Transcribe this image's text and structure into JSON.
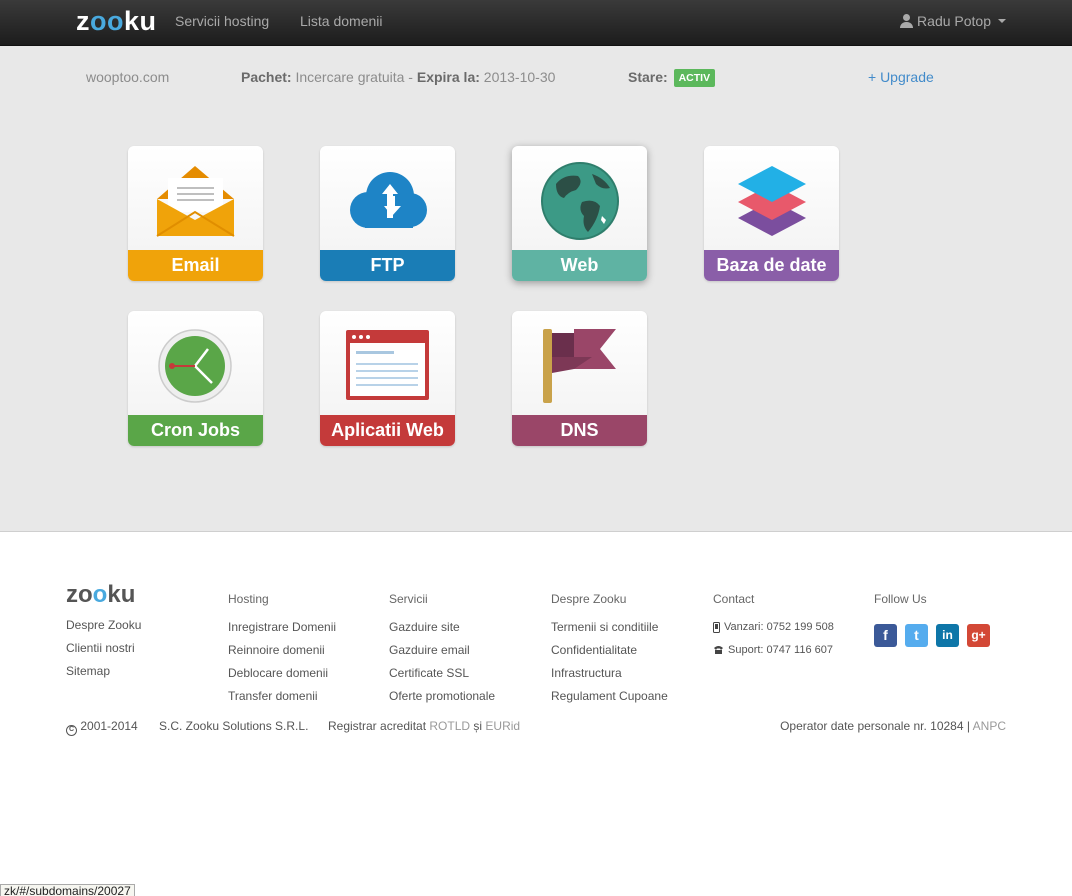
{
  "navbar": {
    "logo": {
      "part1": "zoo",
      "part2": "k",
      "part3": "u"
    },
    "links": [
      "Servicii hosting",
      "Lista domenii"
    ],
    "user": "Radu Potop"
  },
  "info": {
    "domain": "wooptoo.com",
    "package_label": "Pachet:",
    "package_value": "Incercare gratuita -",
    "expires_label": "Expira la:",
    "expires_value": "2013-10-30",
    "status_label": "Stare:",
    "status_badge": "ACTIV",
    "upgrade": "+ Upgrade"
  },
  "tiles": [
    {
      "label": "Email",
      "icon": "envelope-icon",
      "color": "#f0a30a"
    },
    {
      "label": "FTP",
      "icon": "cloud-transfer-icon",
      "color": "#1a7db6"
    },
    {
      "label": "Web",
      "icon": "globe-icon",
      "color": "#5fb3a3"
    },
    {
      "label": "Baza de date",
      "icon": "database-layers-icon",
      "color": "#8a5ea8"
    },
    {
      "label": "Cron Jobs",
      "icon": "clock-icon",
      "color": "#5aa648"
    },
    {
      "label": "Aplicatii Web",
      "icon": "browser-window-icon",
      "color": "#c43a3a"
    },
    {
      "label": "DNS",
      "icon": "flag-icon",
      "color": "#9a4668"
    }
  ],
  "footer": {
    "logo": {
      "part1": "zoo",
      "part2": "ku"
    },
    "about": [
      "Despre Zooku",
      "Clientii nostri",
      "Sitemap"
    ],
    "hosting": {
      "head": "Hosting",
      "items": [
        "Inregistrare Domenii",
        "Reinnoire domenii",
        "Deblocare domenii",
        "Transfer domenii"
      ]
    },
    "servicii": {
      "head": "Servicii",
      "items": [
        "Gazduire site",
        "Gazduire email",
        "Certificate SSL",
        "Oferte promotionale"
      ]
    },
    "despre": {
      "head": "Despre Zooku",
      "items": [
        "Termenii si conditiile",
        "Confidentialitate",
        "Infrastructura",
        "Regulament Cupoane"
      ]
    },
    "contact": {
      "head": "Contact",
      "sales": "Vanzari: 0752 199 508",
      "support": "Suport: 0747 116 607"
    },
    "follow": {
      "head": "Follow Us",
      "networks": [
        "facebook-icon",
        "twitter-icon",
        "linkedin-icon",
        "google-plus-icon"
      ]
    },
    "copyright_symbol": "C",
    "copyright_years": "2001-2014",
    "company": "S.C. Zooku Solutions S.R.L.",
    "registrar_text": "Registrar acreditat",
    "rotld": "ROTLD",
    "si": "și",
    "eurid": "EURid",
    "operator_text": "Operator date personale nr. 10284 |",
    "anpc": "ANPC"
  },
  "status_bar_url": "zk/#/subdomains/20027"
}
